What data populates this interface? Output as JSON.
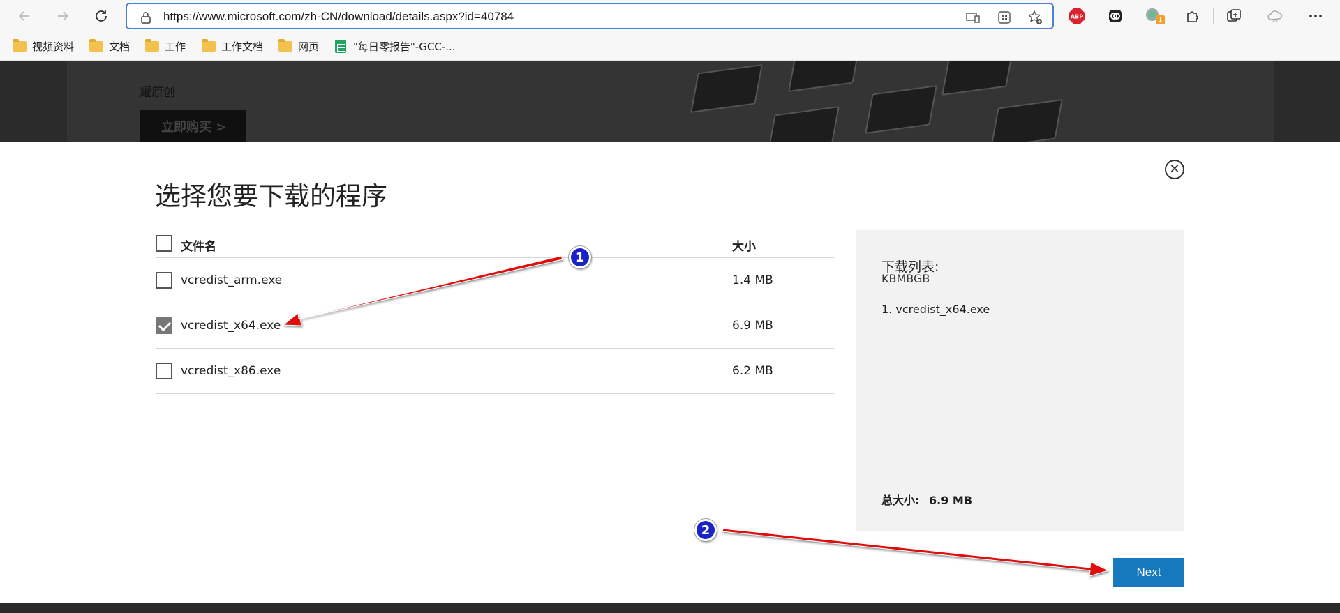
{
  "browser": {
    "url": "https://www.microsoft.com/zh-CN/download/details.aspx?id=40784",
    "bookmarks": [
      {
        "label": "视频资料",
        "type": "folder"
      },
      {
        "label": "文档",
        "type": "folder"
      },
      {
        "label": "工作",
        "type": "folder"
      },
      {
        "label": "工作文档",
        "type": "folder"
      },
      {
        "label": "网页",
        "type": "folder"
      },
      {
        "label": "\"每日零报告\"-GCC-...",
        "type": "sheet"
      }
    ],
    "extension_badge": "1"
  },
  "banner": {
    "subtitle": "耀原创",
    "buy_button": "立即购买 >"
  },
  "dialog": {
    "title": "选择您要下载的程序",
    "close_symbol": "✕",
    "table": {
      "header_name": "文件名",
      "header_size": "大小",
      "rows": [
        {
          "name": "vcredist_arm.exe",
          "size": "1.4 MB",
          "checked": false
        },
        {
          "name": "vcredist_x64.exe",
          "size": "6.9 MB",
          "checked": true
        },
        {
          "name": "vcredist_x86.exe",
          "size": "6.2 MB",
          "checked": false
        }
      ]
    },
    "summary": {
      "title": "下载列表:",
      "subtitle": "KBMBGB",
      "items": [
        "1. vcredist_x64.exe"
      ],
      "total_label": "总大小:",
      "total_value": "6.9 MB"
    },
    "next_label": "Next"
  },
  "annotations": {
    "badge1": "1",
    "badge2": "2",
    "color": "#e01010"
  }
}
